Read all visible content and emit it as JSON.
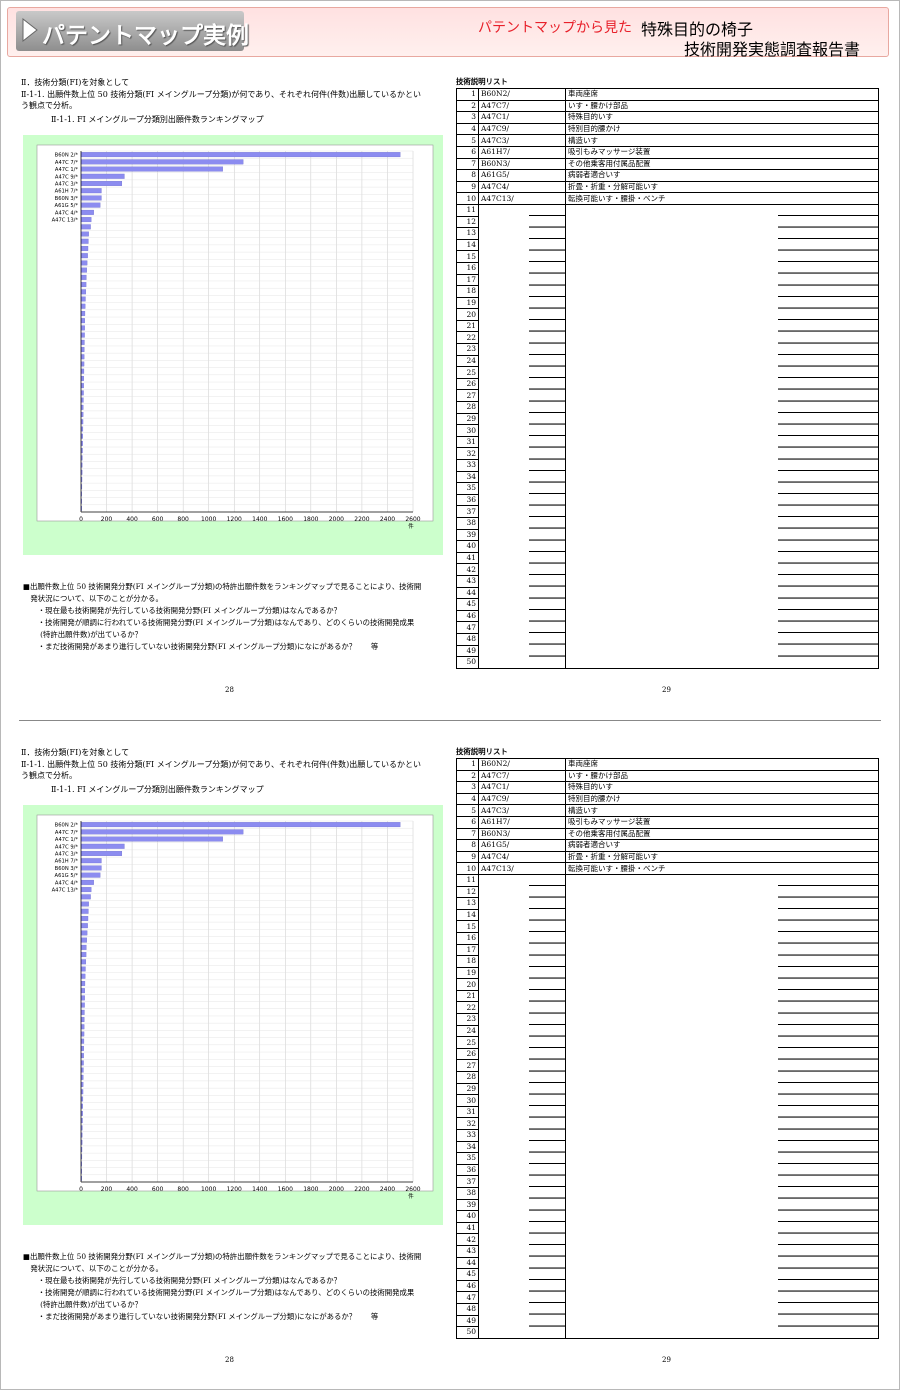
{
  "banner": {
    "left_title": "パテントマップ実例",
    "red_text": "パテントマップから見た",
    "right_line1": "特殊目的の椅子",
    "right_line2": "技術開発実態調査報告書"
  },
  "spread": {
    "heading_section": "Ⅱ．技術分類(FI)を対象として",
    "heading_line1": "Ⅱ-1-1. 出願件数上位 50 技術分類(FI メイングループ分類)が何であり、それぞれ何件(件数)出願しているかとい",
    "heading_line2": "う観点で分析。",
    "chart_caption": "Ⅱ-1-1. FI メイングループ分類別出願件数ランキングマップ",
    "para_lines": [
      "■出願件数上位 50 技術開発分野(FI メイングループ分類)の特許出願件数をランキングマップで見ることにより、技術開",
      "　発状況について、以下のことが分かる。",
      "　　・現在最も技術開発が先行している技術開発分野(FI メイングループ分類)はなんであるか？",
      "　　・技術開発が順調に行われている技術開発分野(FI メイングループ分類)はなんであり、どのくらいの技術開発成果",
      "　　 (特許出願件数)が出ているか？",
      "　　・まだ技術開発があまり進行していない技術開発分野(FI メイングループ分類)になにがあるか？　　等"
    ],
    "page_left": "28",
    "page_right": "29",
    "list_title": "技術説明リスト",
    "list_rows": [
      {
        "no": "1",
        "code": "B60N2/",
        "desc": "車両座席"
      },
      {
        "no": "2",
        "code": "A47C7/",
        "desc": "いす・腰かけ部品"
      },
      {
        "no": "3",
        "code": "A47C1/",
        "desc": "特殊目的いす"
      },
      {
        "no": "4",
        "code": "A47C9/",
        "desc": "特別目的腰かけ"
      },
      {
        "no": "5",
        "code": "A47C3/",
        "desc": "構造いす"
      },
      {
        "no": "6",
        "code": "A61H7/",
        "desc": "吸引もみマッサージ装置"
      },
      {
        "no": "7",
        "code": "B60N3/",
        "desc": "その他乗客用付属品配置"
      },
      {
        "no": "8",
        "code": "A61G5/",
        "desc": "病弱者適合いす"
      },
      {
        "no": "9",
        "code": "A47C4/",
        "desc": "折畳・折重・分解可能いす"
      },
      {
        "no": "10",
        "code": "A47C13/",
        "desc": "転換可能いす・腰掛・ベンチ"
      }
    ],
    "list_empty_numbers": [
      "11",
      "12",
      "13",
      "14",
      "15",
      "16",
      "17",
      "18",
      "19",
      "20",
      "21",
      "22",
      "23",
      "24",
      "25",
      "26",
      "27",
      "28",
      "29",
      "30",
      "31",
      "32",
      "33",
      "34",
      "35",
      "36",
      "37",
      "38",
      "39",
      "40",
      "41",
      "42",
      "43",
      "44",
      "45",
      "46",
      "47",
      "48",
      "49",
      "50"
    ]
  },
  "chart_data": {
    "type": "bar",
    "orientation": "horizontal",
    "categories": [
      "B60N 2/*",
      "A47C 7/*",
      "A47C 1/*",
      "A47C 9/*",
      "A47C 3/*",
      "A61H 7/*",
      "B60N 3/*",
      "A61G 5/*",
      "A47C 4/*",
      "A47C 13/*"
    ],
    "values": [
      2500,
      1270,
      1110,
      340,
      320,
      160,
      160,
      150,
      100,
      80,
      75,
      60,
      58,
      55,
      52,
      48,
      45,
      42,
      40,
      38,
      35,
      33,
      31,
      30,
      29,
      28,
      27,
      26,
      25,
      24,
      23,
      22,
      21,
      20,
      19,
      18,
      17,
      16,
      15,
      14,
      13,
      12,
      11,
      10,
      9,
      8,
      7,
      6,
      5,
      4
    ],
    "xlim": [
      0,
      2600
    ],
    "xticks": [
      "0",
      "200",
      "400",
      "600",
      "800",
      "1000",
      "1200",
      "1400",
      "1600",
      "1800",
      "2000",
      "2200",
      "2400",
      "2600"
    ],
    "xunit": "件",
    "bar_color": "#8c8cf0",
    "background": "#ccffcc",
    "grid": true
  }
}
